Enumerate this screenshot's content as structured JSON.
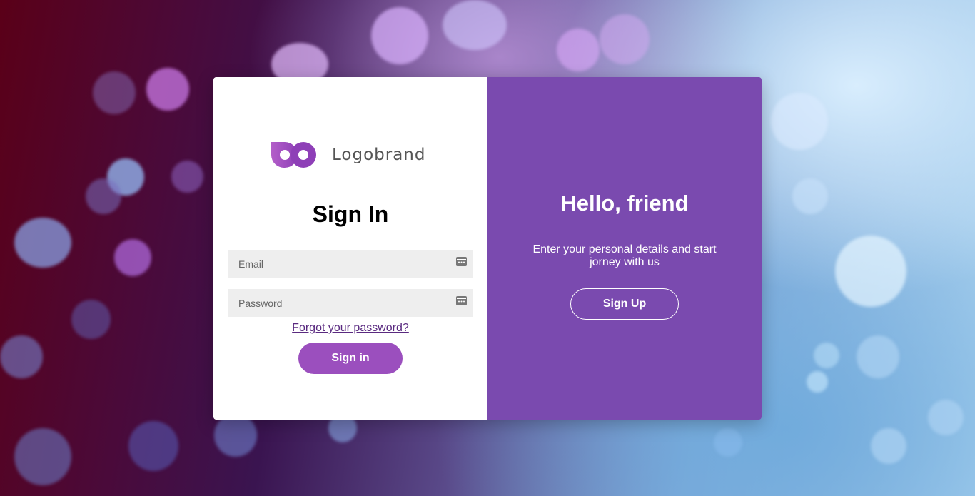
{
  "brand": {
    "name": "Logobrand",
    "icon": "infinity-logo-icon",
    "colors": {
      "primary": "#8e3fb7",
      "secondary": "#b35ec9"
    }
  },
  "signin": {
    "title": "Sign In",
    "email_placeholder": "Email",
    "email_value": "",
    "password_placeholder": "Password",
    "password_value": "",
    "field_icon": "password-manager-key-icon",
    "forgot_link": "Forgot your password?",
    "button_label": "Sign in"
  },
  "panel": {
    "title": "Hello, friend",
    "text": "Enter your personal details and start jorney with us",
    "button_label": "Sign Up",
    "color": "#7a4aaf"
  }
}
